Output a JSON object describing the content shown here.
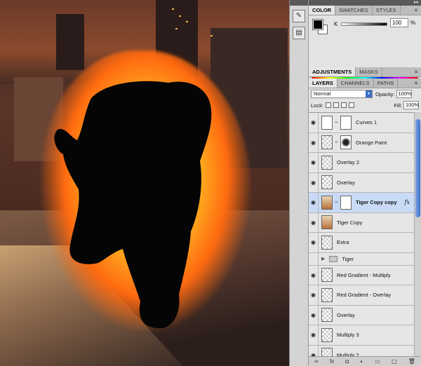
{
  "color_panel": {
    "tabs": [
      "COLOR",
      "SWATCHES",
      "STYLES"
    ],
    "k_label": "K",
    "k_value": "100",
    "k_unit": "%"
  },
  "adjust_tabs": [
    "ADJUSTMENTS",
    "MASKS"
  ],
  "layers_panel": {
    "tabs": [
      "LAYERS",
      "CHANNELS",
      "PATHS"
    ],
    "blend_mode": "Normal",
    "opacity_label": "Opacity:",
    "opacity_value": "100%",
    "lock_label": "Lock:",
    "fill_label": "Fill:",
    "fill_value": "100%",
    "layers": [
      {
        "name": "Curves 1",
        "fx": ""
      },
      {
        "name": "Orange Paint",
        "fx": ""
      },
      {
        "name": "Overlay 2",
        "fx": ""
      },
      {
        "name": "Overlay",
        "fx": ""
      },
      {
        "name": "Tiger Copy copy",
        "fx": "fx"
      },
      {
        "name": "Tiger Copy",
        "fx": ""
      },
      {
        "name": "Extra",
        "fx": ""
      },
      {
        "name": "Tiger",
        "fx": ""
      },
      {
        "name": "Red Gradient - Multiply",
        "fx": ""
      },
      {
        "name": "Red Gradient - Overlay",
        "fx": ""
      },
      {
        "name": "Overlay",
        "fx": ""
      },
      {
        "name": "Multiply 3",
        "fx": ""
      },
      {
        "name": "Multiply 2",
        "fx": ""
      }
    ],
    "bottom_icons": [
      "link-icon",
      "fx-icon",
      "mask-icon",
      "adjustment-icon",
      "group-icon",
      "new-layer-icon",
      "trash-icon"
    ],
    "bottom_glyphs": [
      "∞",
      "fx",
      "◘",
      "◐",
      "▭",
      "▢",
      "🗑"
    ]
  }
}
